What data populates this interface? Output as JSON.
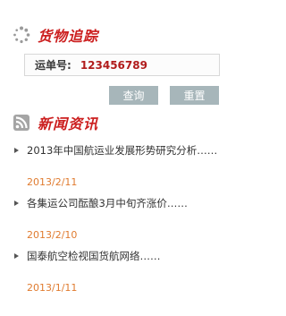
{
  "tracking": {
    "title": "货物追踪",
    "label": "运单号:",
    "value": "123456789",
    "query_label": "查询",
    "reset_label": "重置"
  },
  "news": {
    "title": "新闻资讯",
    "items": [
      {
        "title": "2013年中国航运业发展形势研究分析……",
        "date": "2013/2/11"
      },
      {
        "title": "各集运公司酝酿3月中旬齐涨价……",
        "date": "2013/2/10"
      },
      {
        "title": "国泰航空检视国货航网络……",
        "date": "2013/1/11"
      }
    ]
  },
  "colors": {
    "accent": "#cc1f1f",
    "date": "#e07b2f",
    "button": "#a7b6ba"
  }
}
